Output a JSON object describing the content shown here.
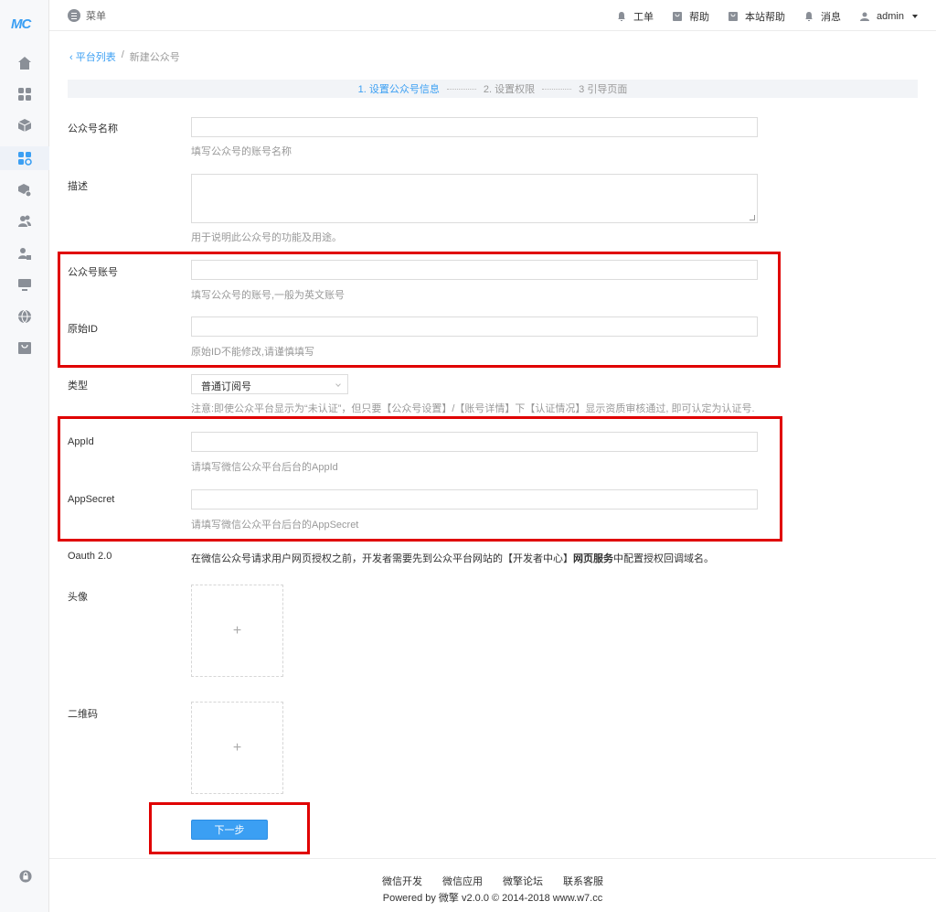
{
  "sidebar": {
    "logo": "MC",
    "items": [
      {
        "icon": "home-icon"
      },
      {
        "icon": "apps-icon"
      },
      {
        "icon": "cube-icon"
      },
      {
        "icon": "apps-settings-icon"
      },
      {
        "icon": "box-settings-icon"
      },
      {
        "icon": "users-icon"
      },
      {
        "icon": "user-lock-icon"
      },
      {
        "icon": "monitor-icon"
      },
      {
        "icon": "globe-icon"
      },
      {
        "icon": "store-icon"
      }
    ]
  },
  "topbar": {
    "menu_label": "菜单",
    "items": [
      {
        "label": "工单",
        "icon": "bell-icon"
      },
      {
        "label": "帮助",
        "icon": "store-icon"
      },
      {
        "label": "本站帮助",
        "icon": "store-icon"
      },
      {
        "label": "消息",
        "icon": "bell-icon"
      }
    ],
    "user": "admin"
  },
  "breadcrumb": {
    "back_label": "平台列表",
    "separator": "/",
    "current": "新建公众号"
  },
  "steps": [
    "1. 设置公众号信息",
    "2. 设置权限",
    "3 引导页面"
  ],
  "form": {
    "name": {
      "label": "公众号名称",
      "help": "填写公众号的账号名称"
    },
    "desc": {
      "label": "描述",
      "help": "用于说明此公众号的功能及用途。"
    },
    "account": {
      "label": "公众号账号",
      "help": "填写公众号的账号,一般为英文账号"
    },
    "original_id": {
      "label": "原始ID",
      "help": "原始ID不能修改,请谨慎填写"
    },
    "type": {
      "label": "类型",
      "value": "普通订阅号",
      "help": "注意:即使公众平台显示为“未认证”，但只要【公众号设置】/【账号详情】下【认证情况】显示资质审核通过, 即可认定为认证号."
    },
    "appid": {
      "label": "AppId",
      "help": "请填写微信公众平台后台的AppId"
    },
    "appsecret": {
      "label": "AppSecret",
      "help": "请填写微信公众平台后台的AppSecret"
    },
    "oauth": {
      "label": "Oauth 2.0",
      "text_before": "在微信公众号请求用户网页授权之前，开发者需要先到公众平台网站的【开发者中心】",
      "text_bold": "网页服务",
      "text_after": "中配置授权回调域名。"
    },
    "avatar": {
      "label": "头像",
      "plus": "+"
    },
    "qrcode": {
      "label": "二维码",
      "plus": "+"
    },
    "next_button": "下一步"
  },
  "footer": {
    "links": [
      "微信开发",
      "微信应用",
      "微擎论坛",
      "联系客服"
    ],
    "copyright": "Powered by 微擎 v2.0.0 © 2014-2018 www.w7.cc"
  },
  "colors": {
    "accent": "#3b9ff3",
    "highlight": "#e00000",
    "sidebar_icon": "#8a8f97"
  }
}
